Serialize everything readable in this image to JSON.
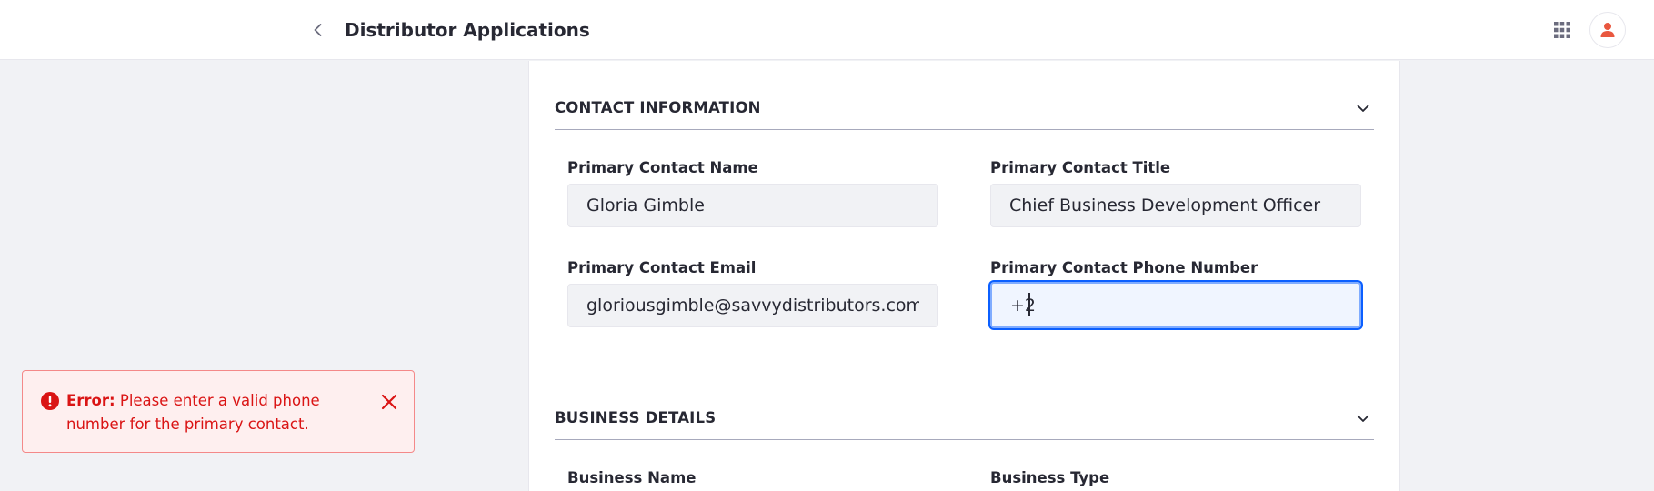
{
  "header": {
    "title": "Distributor Applications",
    "back_icon": "chevron-left-icon",
    "apps_icon": "grid-icon",
    "avatar_icon": "user-icon",
    "avatar_color": "#e9573f"
  },
  "sections": {
    "contact": {
      "title": "CONTACT INFORMATION",
      "fields": {
        "name": {
          "label": "Primary Contact Name",
          "value": "Gloria Gimble"
        },
        "title": {
          "label": "Primary Contact Title",
          "value": "Chief Business Development Officer"
        },
        "email": {
          "label": "Primary Contact Email",
          "value": "gloriousgimble@savvydistributors.com"
        },
        "phone": {
          "label": "Primary Contact Phone Number",
          "value": "+2"
        }
      }
    },
    "business": {
      "title": "BUSINESS DETAILS",
      "fields": {
        "name": {
          "label": "Business Name"
        },
        "type": {
          "label": "Business Type"
        }
      }
    }
  },
  "toast": {
    "prefix": "Error:",
    "message": "Please enter a valid phone number for the primary contact.",
    "color": "#da1414"
  }
}
